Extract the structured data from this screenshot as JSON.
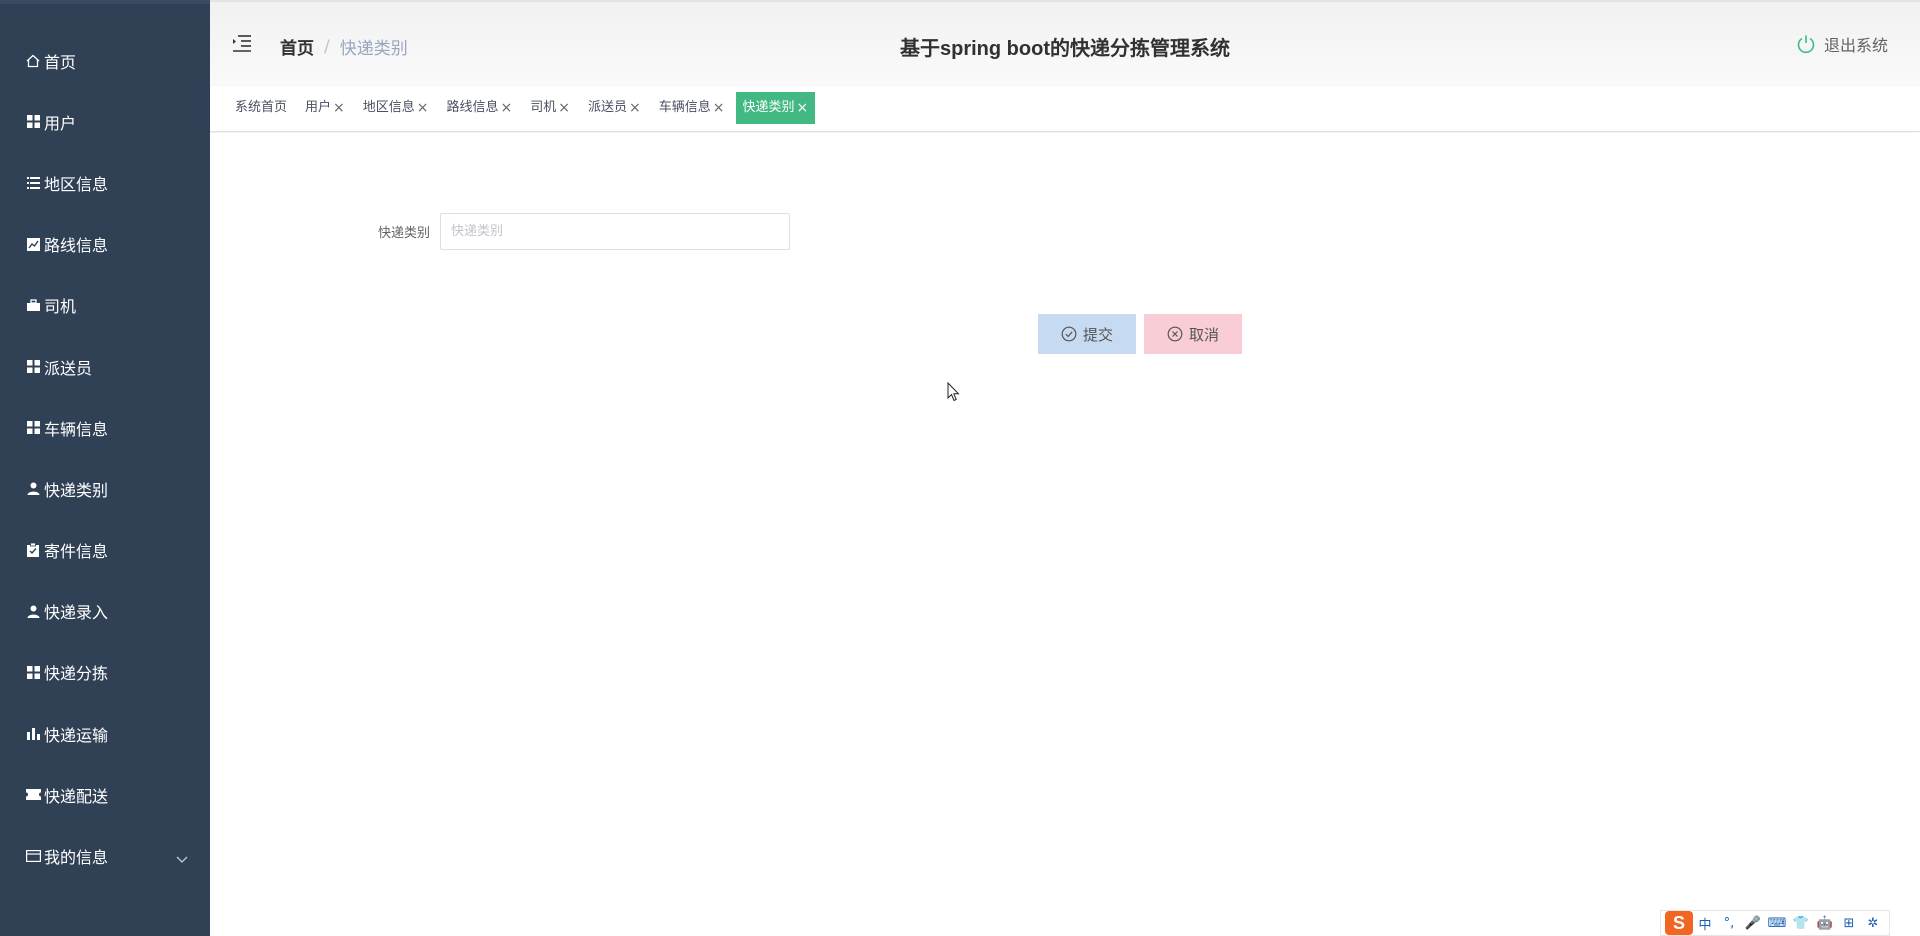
{
  "sidebar": {
    "items": [
      {
        "label": "首页",
        "icon": "home-icon"
      },
      {
        "label": "用户",
        "icon": "grid-icon"
      },
      {
        "label": "地区信息",
        "icon": "list-icon"
      },
      {
        "label": "路线信息",
        "icon": "chart-image-icon"
      },
      {
        "label": "司机",
        "icon": "briefcase-icon"
      },
      {
        "label": "派送员",
        "icon": "grid-icon"
      },
      {
        "label": "车辆信息",
        "icon": "grid-icon"
      },
      {
        "label": "快递类别",
        "icon": "user-icon"
      },
      {
        "label": "寄件信息",
        "icon": "clipboard-icon"
      },
      {
        "label": "快递录入",
        "icon": "user-icon"
      },
      {
        "label": "快递分拣",
        "icon": "grid-icon"
      },
      {
        "label": "快递运输",
        "icon": "bar-chart-icon"
      },
      {
        "label": "快递配送",
        "icon": "ticket-icon"
      },
      {
        "label": "我的信息",
        "icon": "card-icon"
      }
    ]
  },
  "header": {
    "breadcrumb_home": "首页",
    "breadcrumb_sep": "/",
    "breadcrumb_current": "快递类别",
    "title": "基于spring boot的快递分拣管理系统",
    "logout_label": "退出系统"
  },
  "tags": [
    {
      "label": "系统首页",
      "closable": false,
      "active": false
    },
    {
      "label": "用户",
      "closable": true,
      "active": false
    },
    {
      "label": "地区信息",
      "closable": true,
      "active": false
    },
    {
      "label": "路线信息",
      "closable": true,
      "active": false
    },
    {
      "label": "司机",
      "closable": true,
      "active": false
    },
    {
      "label": "派送员",
      "closable": true,
      "active": false
    },
    {
      "label": "车辆信息",
      "closable": true,
      "active": false
    },
    {
      "label": "快递类别",
      "closable": true,
      "active": true
    }
  ],
  "tag_close_glyph": "×",
  "form": {
    "label": "快递类别",
    "value": "",
    "placeholder": "快递类别",
    "submit_label": "提交",
    "cancel_label": "取消"
  },
  "ime": {
    "logo": "S",
    "items": [
      "中",
      "°,",
      "🎤",
      "⌨",
      "👕",
      "🤖",
      "⊞",
      "✲"
    ]
  },
  "colors": {
    "sidebar_bg": "#304156",
    "active_tag": "#42b983",
    "submit_bg": "#c6daf2",
    "cancel_bg": "#f8cdd6"
  }
}
